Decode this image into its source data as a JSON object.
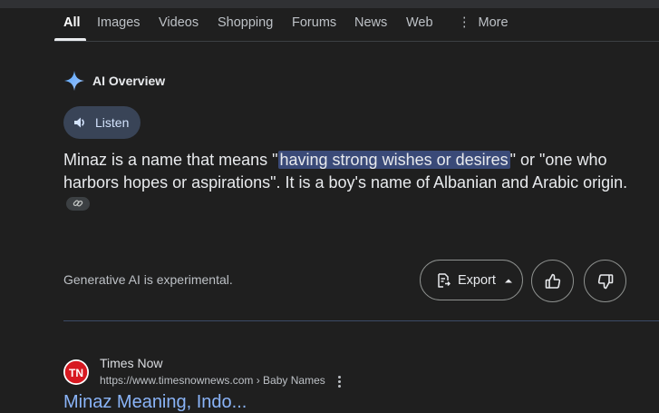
{
  "tabs": {
    "all": "All",
    "images": "Images",
    "videos": "Videos",
    "shopping": "Shopping",
    "forums": "Forums",
    "news": "News",
    "web": "Web",
    "more": "More"
  },
  "ai_overview": {
    "title": "AI Overview",
    "listen_label": "Listen",
    "answer": {
      "before": "Minaz is a name that means \"",
      "highlight": "having strong wishes or desires",
      "after": "\" or \"one who harbors hopes or aspirations\". It is a boy's name of Albanian and Arabic origin."
    },
    "disclaimer": "Generative AI is experimental.",
    "export_label": "Export"
  },
  "result": {
    "site_name": "Times Now",
    "url": "https://www.timesnownews.com › Baby Names",
    "favicon_text": "TN",
    "title": "Minaz Meaning, Indo..."
  },
  "colors": {
    "background": "#1f1f1f",
    "highlight": "#3a4a78",
    "listen_bg": "#394457",
    "link_blue": "#8ab4f8",
    "favicon_red": "#d71921"
  }
}
